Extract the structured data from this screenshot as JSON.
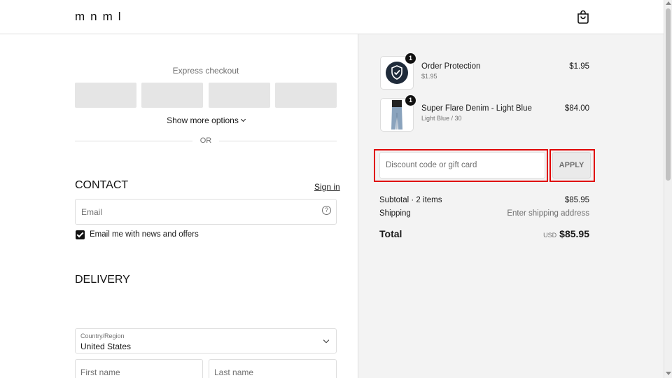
{
  "header": {
    "logo": "mnml",
    "cart_icon": "shopping-bag-icon"
  },
  "express": {
    "title": "Express checkout",
    "show_more": "Show more options",
    "divider": "OR"
  },
  "contact": {
    "title": "CONTACT",
    "sign_in": "Sign in",
    "email_placeholder": "Email",
    "email_value": "",
    "help_icon": "question-circle-icon",
    "news_label": "Email me with news and offers",
    "news_checked": true
  },
  "delivery": {
    "title": "DELIVERY",
    "country_label": "Country/Region",
    "country_value": "United States",
    "first_name_placeholder": "First name",
    "last_name_placeholder": "Last name"
  },
  "order": {
    "items": [
      {
        "name": "Order Protection",
        "sub": "$1.95",
        "price": "$1.95",
        "qty": "1",
        "thumb_icon": "shield-check-icon"
      },
      {
        "name": "Super Flare Denim - Light Blue",
        "sub": "Light Blue / 30",
        "price": "$84.00",
        "qty": "1",
        "thumb_icon": "jeans-photo"
      }
    ],
    "discount_placeholder": "Discount code or gift card",
    "discount_value": "",
    "apply_label": "APPLY",
    "subtotal_label": "Subtotal · 2 items",
    "subtotal_value": "$85.95",
    "shipping_label": "Shipping",
    "shipping_value": "Enter shipping address",
    "total_label": "Total",
    "currency": "USD",
    "total_value": "$85.95"
  },
  "colors": {
    "highlight": "#e00000",
    "panel_bg": "#f3f3f3",
    "dark": "#111111"
  }
}
